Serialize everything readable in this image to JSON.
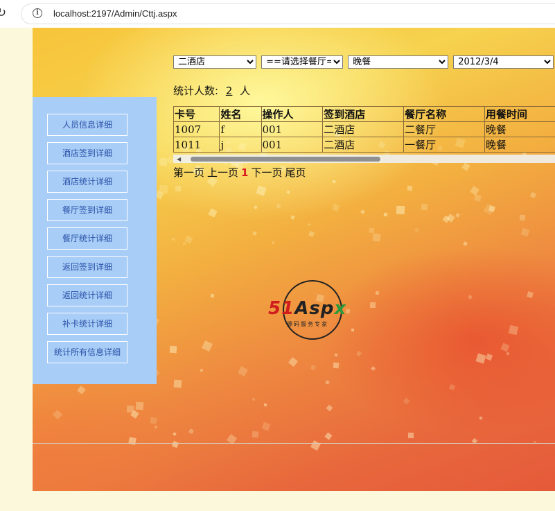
{
  "browser": {
    "url": "localhost:2197/Admin/Cttj.aspx"
  },
  "filters": {
    "hotel": {
      "selected": "二酒店"
    },
    "restaurant": {
      "selected": "==请选择餐厅=="
    },
    "meal": {
      "selected": "晚餐"
    },
    "date": {
      "selected": "2012/3/4"
    }
  },
  "stats": {
    "label": "统计人数:",
    "count": "2",
    "unit": "人"
  },
  "table": {
    "headers": [
      "卡号",
      "姓名",
      "操作人",
      "签到酒店",
      "餐厅名称",
      "用餐时间"
    ],
    "rows": [
      [
        "1007",
        "f",
        "001",
        "二酒店",
        "二餐厅",
        "晚餐"
      ],
      [
        "1011",
        "j",
        "001",
        "二酒店",
        "一餐厅",
        "晚餐"
      ]
    ]
  },
  "pager": {
    "first": "第一页",
    "prev": "上一页",
    "current": "1",
    "next": "下一页",
    "last": "尾页"
  },
  "sidebar": {
    "items": [
      {
        "label": "人员信息详细"
      },
      {
        "label": "酒店签到详细"
      },
      {
        "label": "酒店统计详细"
      },
      {
        "label": "餐厅签到详细"
      },
      {
        "label": "餐厅统计详细"
      },
      {
        "label": "返回签到详细"
      },
      {
        "label": "返回统计详细"
      },
      {
        "label": "补卡统计详细"
      },
      {
        "label": "统计所有信息详细"
      }
    ]
  },
  "logo": {
    "mark": "51Aspx",
    "tagline": "源码服务专家"
  }
}
